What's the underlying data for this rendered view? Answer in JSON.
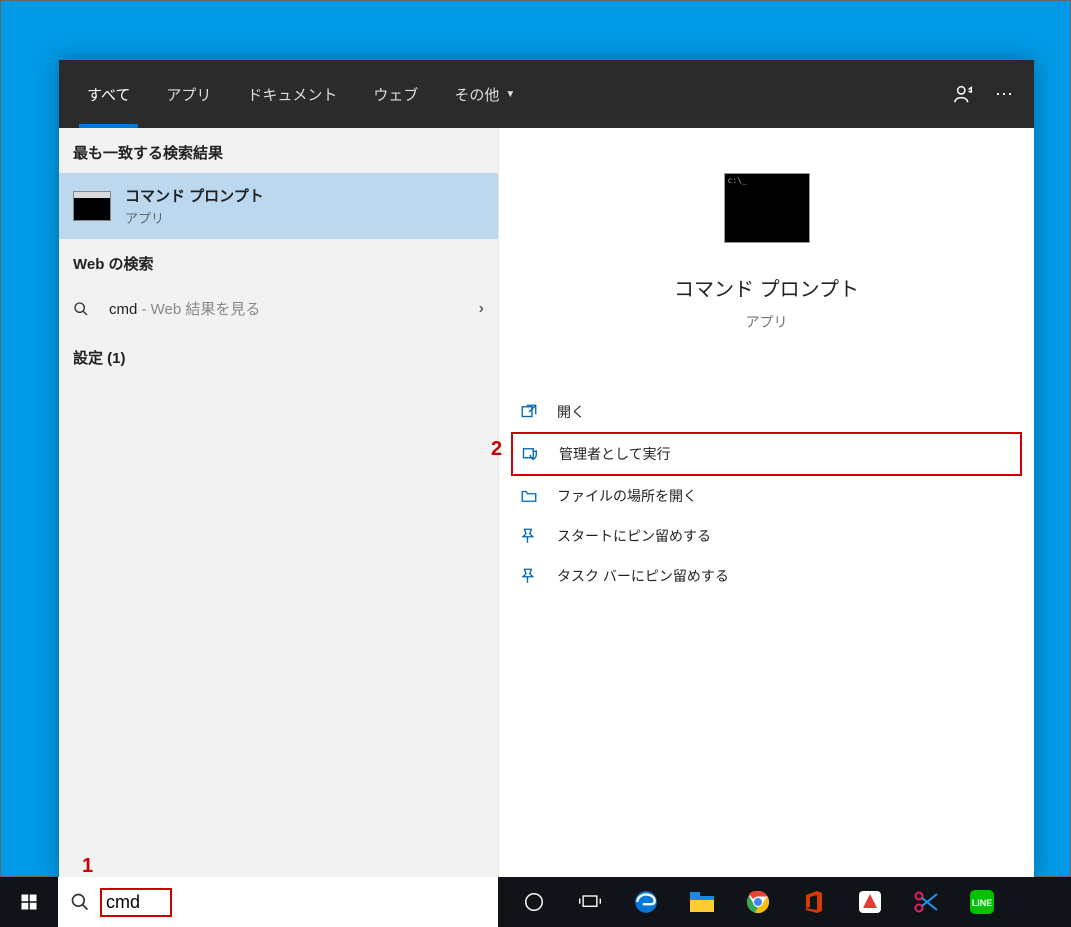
{
  "tabs": {
    "all": "すべて",
    "apps": "アプリ",
    "documents": "ドキュメント",
    "web": "ウェブ",
    "more": "その他"
  },
  "left": {
    "best_match_label": "最も一致する検索結果",
    "result_title": "コマンド プロンプト",
    "result_sub": "アプリ",
    "web_search_label": "Web の検索",
    "web_query": "cmd",
    "web_suffix": " - Web 結果を見る",
    "settings_label": "設定 (1)"
  },
  "right": {
    "title": "コマンド プロンプト",
    "sub": "アプリ",
    "actions": {
      "open": "開く",
      "run_admin": "管理者として実行",
      "open_location": "ファイルの場所を開く",
      "pin_start": "スタートにピン留めする",
      "pin_taskbar": "タスク バーにピン留めする"
    }
  },
  "search_input": "cmd",
  "annotations": {
    "one": "1",
    "two": "2"
  }
}
